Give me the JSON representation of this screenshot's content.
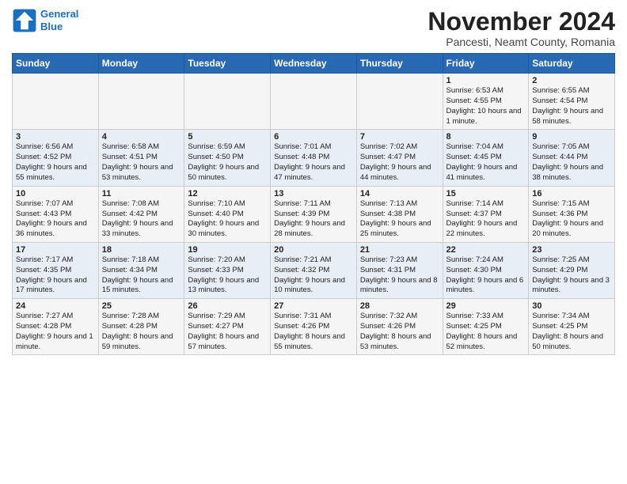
{
  "logo": {
    "line1": "General",
    "line2": "Blue"
  },
  "title": "November 2024",
  "subtitle": "Pancesti, Neamt County, Romania",
  "days_header": [
    "Sunday",
    "Monday",
    "Tuesday",
    "Wednesday",
    "Thursday",
    "Friday",
    "Saturday"
  ],
  "weeks": [
    [
      {
        "day": "",
        "info": ""
      },
      {
        "day": "",
        "info": ""
      },
      {
        "day": "",
        "info": ""
      },
      {
        "day": "",
        "info": ""
      },
      {
        "day": "",
        "info": ""
      },
      {
        "day": "1",
        "info": "Sunrise: 6:53 AM\nSunset: 4:55 PM\nDaylight: 10 hours and 1 minute."
      },
      {
        "day": "2",
        "info": "Sunrise: 6:55 AM\nSunset: 4:54 PM\nDaylight: 9 hours and 58 minutes."
      }
    ],
    [
      {
        "day": "3",
        "info": "Sunrise: 6:56 AM\nSunset: 4:52 PM\nDaylight: 9 hours and 55 minutes."
      },
      {
        "day": "4",
        "info": "Sunrise: 6:58 AM\nSunset: 4:51 PM\nDaylight: 9 hours and 53 minutes."
      },
      {
        "day": "5",
        "info": "Sunrise: 6:59 AM\nSunset: 4:50 PM\nDaylight: 9 hours and 50 minutes."
      },
      {
        "day": "6",
        "info": "Sunrise: 7:01 AM\nSunset: 4:48 PM\nDaylight: 9 hours and 47 minutes."
      },
      {
        "day": "7",
        "info": "Sunrise: 7:02 AM\nSunset: 4:47 PM\nDaylight: 9 hours and 44 minutes."
      },
      {
        "day": "8",
        "info": "Sunrise: 7:04 AM\nSunset: 4:45 PM\nDaylight: 9 hours and 41 minutes."
      },
      {
        "day": "9",
        "info": "Sunrise: 7:05 AM\nSunset: 4:44 PM\nDaylight: 9 hours and 38 minutes."
      }
    ],
    [
      {
        "day": "10",
        "info": "Sunrise: 7:07 AM\nSunset: 4:43 PM\nDaylight: 9 hours and 36 minutes."
      },
      {
        "day": "11",
        "info": "Sunrise: 7:08 AM\nSunset: 4:42 PM\nDaylight: 9 hours and 33 minutes."
      },
      {
        "day": "12",
        "info": "Sunrise: 7:10 AM\nSunset: 4:40 PM\nDaylight: 9 hours and 30 minutes."
      },
      {
        "day": "13",
        "info": "Sunrise: 7:11 AM\nSunset: 4:39 PM\nDaylight: 9 hours and 28 minutes."
      },
      {
        "day": "14",
        "info": "Sunrise: 7:13 AM\nSunset: 4:38 PM\nDaylight: 9 hours and 25 minutes."
      },
      {
        "day": "15",
        "info": "Sunrise: 7:14 AM\nSunset: 4:37 PM\nDaylight: 9 hours and 22 minutes."
      },
      {
        "day": "16",
        "info": "Sunrise: 7:15 AM\nSunset: 4:36 PM\nDaylight: 9 hours and 20 minutes."
      }
    ],
    [
      {
        "day": "17",
        "info": "Sunrise: 7:17 AM\nSunset: 4:35 PM\nDaylight: 9 hours and 17 minutes."
      },
      {
        "day": "18",
        "info": "Sunrise: 7:18 AM\nSunset: 4:34 PM\nDaylight: 9 hours and 15 minutes."
      },
      {
        "day": "19",
        "info": "Sunrise: 7:20 AM\nSunset: 4:33 PM\nDaylight: 9 hours and 13 minutes."
      },
      {
        "day": "20",
        "info": "Sunrise: 7:21 AM\nSunset: 4:32 PM\nDaylight: 9 hours and 10 minutes."
      },
      {
        "day": "21",
        "info": "Sunrise: 7:23 AM\nSunset: 4:31 PM\nDaylight: 9 hours and 8 minutes."
      },
      {
        "day": "22",
        "info": "Sunrise: 7:24 AM\nSunset: 4:30 PM\nDaylight: 9 hours and 6 minutes."
      },
      {
        "day": "23",
        "info": "Sunrise: 7:25 AM\nSunset: 4:29 PM\nDaylight: 9 hours and 3 minutes."
      }
    ],
    [
      {
        "day": "24",
        "info": "Sunrise: 7:27 AM\nSunset: 4:28 PM\nDaylight: 9 hours and 1 minute."
      },
      {
        "day": "25",
        "info": "Sunrise: 7:28 AM\nSunset: 4:28 PM\nDaylight: 8 hours and 59 minutes."
      },
      {
        "day": "26",
        "info": "Sunrise: 7:29 AM\nSunset: 4:27 PM\nDaylight: 8 hours and 57 minutes."
      },
      {
        "day": "27",
        "info": "Sunrise: 7:31 AM\nSunset: 4:26 PM\nDaylight: 8 hours and 55 minutes."
      },
      {
        "day": "28",
        "info": "Sunrise: 7:32 AM\nSunset: 4:26 PM\nDaylight: 8 hours and 53 minutes."
      },
      {
        "day": "29",
        "info": "Sunrise: 7:33 AM\nSunset: 4:25 PM\nDaylight: 8 hours and 52 minutes."
      },
      {
        "day": "30",
        "info": "Sunrise: 7:34 AM\nSunset: 4:25 PM\nDaylight: 8 hours and 50 minutes."
      }
    ]
  ]
}
